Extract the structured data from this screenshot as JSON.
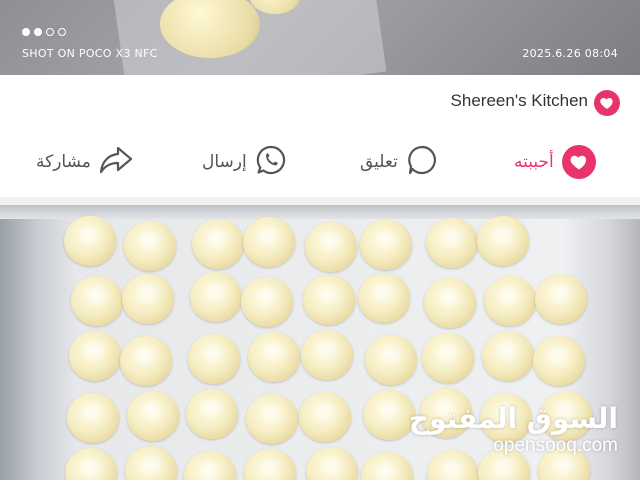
{
  "camera_overlay": {
    "model_text": "SHOT ON POCO X3 NFC",
    "timestamp": "2025.6.26 08:04",
    "dots": [
      true,
      true,
      false,
      false
    ]
  },
  "page": {
    "name": "Shereen's Kitchen",
    "icon": "heart-icon"
  },
  "actions": {
    "like": {
      "label": "أحببته",
      "icon": "heart-icon",
      "active": true
    },
    "comment": {
      "label": "تعليق",
      "icon": "comment-icon"
    },
    "send": {
      "label": "إرسال",
      "icon": "whatsapp-icon"
    },
    "share": {
      "label": "مشاركة",
      "icon": "share-icon"
    }
  },
  "watermark": {
    "arabic": "السوق المفتوح",
    "latin": "opensooq.com"
  },
  "colors": {
    "accent": "#e8336b",
    "text": "#555555"
  }
}
